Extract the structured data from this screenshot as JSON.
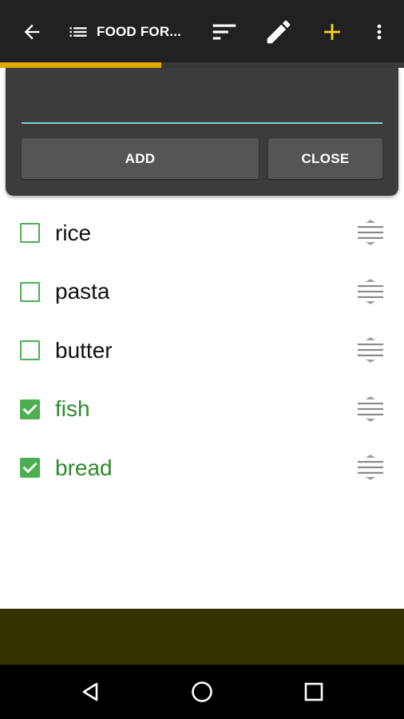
{
  "toolbar": {
    "title": "FOOD FOR...",
    "icons": [
      "back-arrow-icon",
      "list-icon",
      "sort-icon",
      "edit-pencil-icon",
      "add-plus-icon",
      "overflow-menu-icon"
    ],
    "accent_color": "#f5d327",
    "progress": 0.4
  },
  "dialog": {
    "input_value": "",
    "add_label": "ADD",
    "close_label": "CLOSE",
    "underline_color": "#7ecfcf"
  },
  "items": [
    {
      "label": "rice",
      "checked": false
    },
    {
      "label": "pasta",
      "checked": false
    },
    {
      "label": "butter",
      "checked": false
    },
    {
      "label": "fish",
      "checked": true
    },
    {
      "label": "bread",
      "checked": true
    }
  ],
  "colors": {
    "checkbox": "#4caf50",
    "checked_text": "#2e8b2e",
    "bottom_band": "#333300"
  },
  "navbar": {
    "icons": [
      "back-triangle-icon",
      "home-circle-icon",
      "recents-square-icon"
    ]
  }
}
